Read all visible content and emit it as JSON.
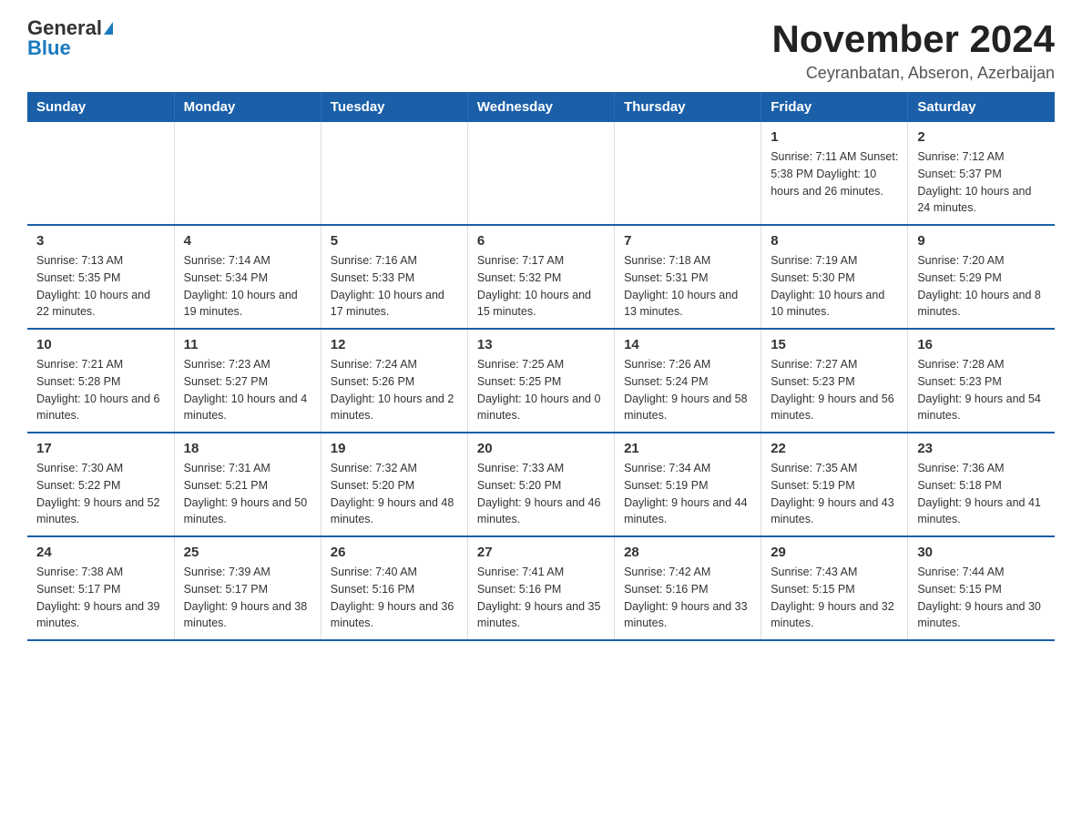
{
  "logo": {
    "general": "General",
    "blue": "Blue"
  },
  "header": {
    "title": "November 2024",
    "subtitle": "Ceyranbatan, Abseron, Azerbaijan"
  },
  "calendar": {
    "days_of_week": [
      "Sunday",
      "Monday",
      "Tuesday",
      "Wednesday",
      "Thursday",
      "Friday",
      "Saturday"
    ],
    "weeks": [
      [
        {
          "day": "",
          "info": ""
        },
        {
          "day": "",
          "info": ""
        },
        {
          "day": "",
          "info": ""
        },
        {
          "day": "",
          "info": ""
        },
        {
          "day": "",
          "info": ""
        },
        {
          "day": "1",
          "info": "Sunrise: 7:11 AM\nSunset: 5:38 PM\nDaylight: 10 hours and 26 minutes."
        },
        {
          "day": "2",
          "info": "Sunrise: 7:12 AM\nSunset: 5:37 PM\nDaylight: 10 hours and 24 minutes."
        }
      ],
      [
        {
          "day": "3",
          "info": "Sunrise: 7:13 AM\nSunset: 5:35 PM\nDaylight: 10 hours and 22 minutes."
        },
        {
          "day": "4",
          "info": "Sunrise: 7:14 AM\nSunset: 5:34 PM\nDaylight: 10 hours and 19 minutes."
        },
        {
          "day": "5",
          "info": "Sunrise: 7:16 AM\nSunset: 5:33 PM\nDaylight: 10 hours and 17 minutes."
        },
        {
          "day": "6",
          "info": "Sunrise: 7:17 AM\nSunset: 5:32 PM\nDaylight: 10 hours and 15 minutes."
        },
        {
          "day": "7",
          "info": "Sunrise: 7:18 AM\nSunset: 5:31 PM\nDaylight: 10 hours and 13 minutes."
        },
        {
          "day": "8",
          "info": "Sunrise: 7:19 AM\nSunset: 5:30 PM\nDaylight: 10 hours and 10 minutes."
        },
        {
          "day": "9",
          "info": "Sunrise: 7:20 AM\nSunset: 5:29 PM\nDaylight: 10 hours and 8 minutes."
        }
      ],
      [
        {
          "day": "10",
          "info": "Sunrise: 7:21 AM\nSunset: 5:28 PM\nDaylight: 10 hours and 6 minutes."
        },
        {
          "day": "11",
          "info": "Sunrise: 7:23 AM\nSunset: 5:27 PM\nDaylight: 10 hours and 4 minutes."
        },
        {
          "day": "12",
          "info": "Sunrise: 7:24 AM\nSunset: 5:26 PM\nDaylight: 10 hours and 2 minutes."
        },
        {
          "day": "13",
          "info": "Sunrise: 7:25 AM\nSunset: 5:25 PM\nDaylight: 10 hours and 0 minutes."
        },
        {
          "day": "14",
          "info": "Sunrise: 7:26 AM\nSunset: 5:24 PM\nDaylight: 9 hours and 58 minutes."
        },
        {
          "day": "15",
          "info": "Sunrise: 7:27 AM\nSunset: 5:23 PM\nDaylight: 9 hours and 56 minutes."
        },
        {
          "day": "16",
          "info": "Sunrise: 7:28 AM\nSunset: 5:23 PM\nDaylight: 9 hours and 54 minutes."
        }
      ],
      [
        {
          "day": "17",
          "info": "Sunrise: 7:30 AM\nSunset: 5:22 PM\nDaylight: 9 hours and 52 minutes."
        },
        {
          "day": "18",
          "info": "Sunrise: 7:31 AM\nSunset: 5:21 PM\nDaylight: 9 hours and 50 minutes."
        },
        {
          "day": "19",
          "info": "Sunrise: 7:32 AM\nSunset: 5:20 PM\nDaylight: 9 hours and 48 minutes."
        },
        {
          "day": "20",
          "info": "Sunrise: 7:33 AM\nSunset: 5:20 PM\nDaylight: 9 hours and 46 minutes."
        },
        {
          "day": "21",
          "info": "Sunrise: 7:34 AM\nSunset: 5:19 PM\nDaylight: 9 hours and 44 minutes."
        },
        {
          "day": "22",
          "info": "Sunrise: 7:35 AM\nSunset: 5:19 PM\nDaylight: 9 hours and 43 minutes."
        },
        {
          "day": "23",
          "info": "Sunrise: 7:36 AM\nSunset: 5:18 PM\nDaylight: 9 hours and 41 minutes."
        }
      ],
      [
        {
          "day": "24",
          "info": "Sunrise: 7:38 AM\nSunset: 5:17 PM\nDaylight: 9 hours and 39 minutes."
        },
        {
          "day": "25",
          "info": "Sunrise: 7:39 AM\nSunset: 5:17 PM\nDaylight: 9 hours and 38 minutes."
        },
        {
          "day": "26",
          "info": "Sunrise: 7:40 AM\nSunset: 5:16 PM\nDaylight: 9 hours and 36 minutes."
        },
        {
          "day": "27",
          "info": "Sunrise: 7:41 AM\nSunset: 5:16 PM\nDaylight: 9 hours and 35 minutes."
        },
        {
          "day": "28",
          "info": "Sunrise: 7:42 AM\nSunset: 5:16 PM\nDaylight: 9 hours and 33 minutes."
        },
        {
          "day": "29",
          "info": "Sunrise: 7:43 AM\nSunset: 5:15 PM\nDaylight: 9 hours and 32 minutes."
        },
        {
          "day": "30",
          "info": "Sunrise: 7:44 AM\nSunset: 5:15 PM\nDaylight: 9 hours and 30 minutes."
        }
      ]
    ]
  }
}
